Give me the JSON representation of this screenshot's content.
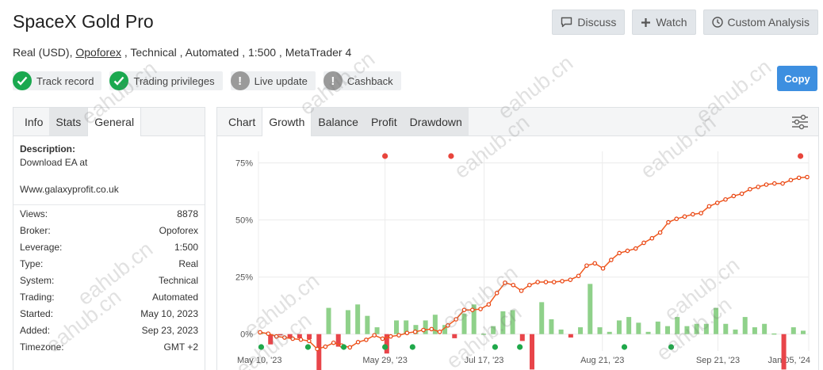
{
  "header": {
    "title": "SpaceX Gold Pro",
    "subtitle_prefix": "Real (USD), ",
    "broker_link": "Opoforex",
    "subtitle_suffix": " , Technical , Automated , 1:500 , MetaTrader 4"
  },
  "actions": {
    "discuss": "Discuss",
    "watch": "Watch",
    "custom": "Custom Analysis",
    "copy": "Copy"
  },
  "badges": [
    {
      "label": "Track record",
      "status": "ok",
      "icon": "check-icon"
    },
    {
      "label": "Trading privileges",
      "status": "ok",
      "icon": "check-icon"
    },
    {
      "label": "Live update",
      "status": "warn",
      "icon": "exclamation-icon"
    },
    {
      "label": "Cashback",
      "status": "warn",
      "icon": "exclamation-icon"
    }
  ],
  "left_tabs": [
    "Info",
    "Stats",
    "General"
  ],
  "description": {
    "label": "Description:",
    "line1": "Download EA at",
    "line2": "Www.galaxyprofit.co.uk"
  },
  "info": [
    {
      "label": "Views:",
      "value": "8878"
    },
    {
      "label": "Broker:",
      "value": "Opoforex"
    },
    {
      "label": "Leverage:",
      "value": "1:500"
    },
    {
      "label": "Type:",
      "value": "Real"
    },
    {
      "label": "System:",
      "value": "Technical"
    },
    {
      "label": "Trading:",
      "value": "Automated"
    },
    {
      "label": "Started:",
      "value": "May 10, 2023"
    },
    {
      "label": "Added:",
      "value": "Sep 23, 2023"
    },
    {
      "label": "Timezone:",
      "value": "GMT +2"
    }
  ],
  "chart_tabs": [
    "Chart",
    "Growth",
    "Balance",
    "Profit",
    "Drawdown"
  ],
  "watermark": "eahub.cn",
  "colors": {
    "line": "#f05a1e",
    "line_point": "#e8410f",
    "bar_pos": "#8fd18a",
    "bar_neg": "#e8454a",
    "marker_red": "#e8453c",
    "marker_green": "#1fa84a",
    "copy_btn": "#3d8fe0"
  },
  "chart_data": {
    "type": "line",
    "ylabels": [
      "75%",
      "50%",
      "25%",
      "0%"
    ],
    "yticks": [
      75,
      50,
      25,
      0
    ],
    "ylim": [
      -6,
      78
    ],
    "xlabels": [
      "May 10, '23",
      "May 29, '23",
      "Jul 17, '23",
      "Aug 21, '23",
      "Sep 21, '23",
      "Jan 05, '24"
    ],
    "series": [
      {
        "values": [
          0.8,
          0.2,
          -1.0,
          -1.5,
          -2.0,
          -2.4,
          -3.0,
          -6.5,
          -5.5,
          -3.8,
          -5.0,
          -5.8,
          -3.5,
          -2.5,
          -0.5,
          -2.0,
          -1.0,
          -0.5,
          0.5,
          1.0,
          1.8,
          2.2,
          1.0,
          3.8,
          6.5,
          10.6,
          10.6,
          11.0,
          13.0,
          18.0,
          22.5,
          21.5,
          19.0,
          21.5,
          22.8,
          22.8,
          22.8,
          23.2,
          23.8,
          25.5,
          30.0,
          31.0,
          28.8,
          32.5,
          35.5,
          36.5,
          37.5,
          40.0,
          42.0,
          44.5,
          49.0,
          50.5,
          51.5,
          52.5,
          53.0,
          56.0,
          57.5,
          59.0,
          60.5,
          61.5,
          63.5,
          64.5,
          65.5,
          66.0,
          66.0,
          67.5,
          68.5,
          68.8
        ]
      }
    ],
    "bars": [
      0.8,
      -4.5,
      -0.5,
      -1.8,
      -1.8,
      -2.2,
      -16.0,
      11.5,
      -5.5,
      10.5,
      13.0,
      8.0,
      3.0,
      -8.5,
      6.0,
      6.0,
      4.0,
      6.0,
      8.5,
      4.0,
      -1.8,
      9.0,
      13.0,
      0.2,
      3.5,
      10.0,
      10.5,
      -3.0,
      -15.5,
      14.0,
      6.5,
      2.0,
      -1.5,
      3.0,
      22.0,
      3.0,
      1.0,
      6.0,
      7.5,
      5.0,
      1.0,
      5.5,
      3.5,
      7.5,
      3.5,
      4.5,
      4.5,
      11.5,
      4.5,
      2.0,
      7.5,
      3.0,
      4.5,
      0.3,
      -15.5,
      3.0,
      1.5
    ],
    "markers_top": [
      0.23,
      0.35,
      0.985
    ],
    "markers_bottom": [
      0.005,
      0.09,
      0.155,
      0.23,
      0.28,
      0.43,
      0.475,
      0.665,
      0.75
    ]
  }
}
